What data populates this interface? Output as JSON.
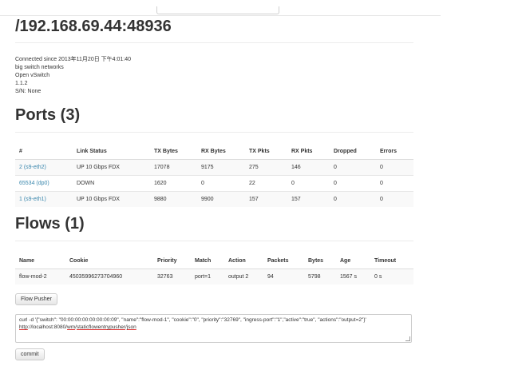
{
  "host_title": "/192.168.69.44:48936",
  "info": [
    "Connected since 2013年11月20日 下午4:01:40",
    "big switch networks",
    "Open vSwitch",
    "1.1.2",
    "S/N: None"
  ],
  "ports": {
    "heading": "Ports (3)",
    "columns": [
      "#",
      "Link Status",
      "TX Bytes",
      "RX Bytes",
      "TX Pkts",
      "RX Pkts",
      "Dropped",
      "Errors"
    ],
    "rows": [
      [
        "2 (s9-eth2)",
        "UP 10 Gbps FDX",
        "17078",
        "9175",
        "275",
        "146",
        "0",
        "0"
      ],
      [
        "65534 (dp0)",
        "DOWN",
        "1620",
        "0",
        "22",
        "0",
        "0",
        "0"
      ],
      [
        "1 (s9-eth1)",
        "UP 10 Gbps FDX",
        "9880",
        "9900",
        "157",
        "157",
        "0",
        "0"
      ]
    ]
  },
  "flows": {
    "heading": "Flows (1)",
    "columns": [
      "Name",
      "Cookie",
      "Priority",
      "Match",
      "Action",
      "Packets",
      "Bytes",
      "Age",
      "Timeout"
    ],
    "rows": [
      [
        "flow-mod-2",
        "45035996273704960",
        "32763",
        "port=1",
        "output 2",
        "94",
        "5798",
        "1567 s",
        "0 s"
      ]
    ]
  },
  "flow_pusher_label": "Flow Pusher",
  "curl": {
    "prefix": "curl -d '{\"switch\": \"00:00:00:00:00:00:00:09\", \"name\":\"flow-mod-1\", \"cookie\":\"0\", \"priority\":\"32769\", \"ingress-port\":\"1\",\"active\":\"true\", \"actions\":\"output=2\"}' ",
    "url_a": "http",
    "url_b": "://localhost:8080/",
    "url_c": "wm",
    "url_d": "/",
    "url_e": "staticflowentrypusher",
    "url_f": "/",
    "url_g": "json"
  },
  "commit_label": "commit"
}
